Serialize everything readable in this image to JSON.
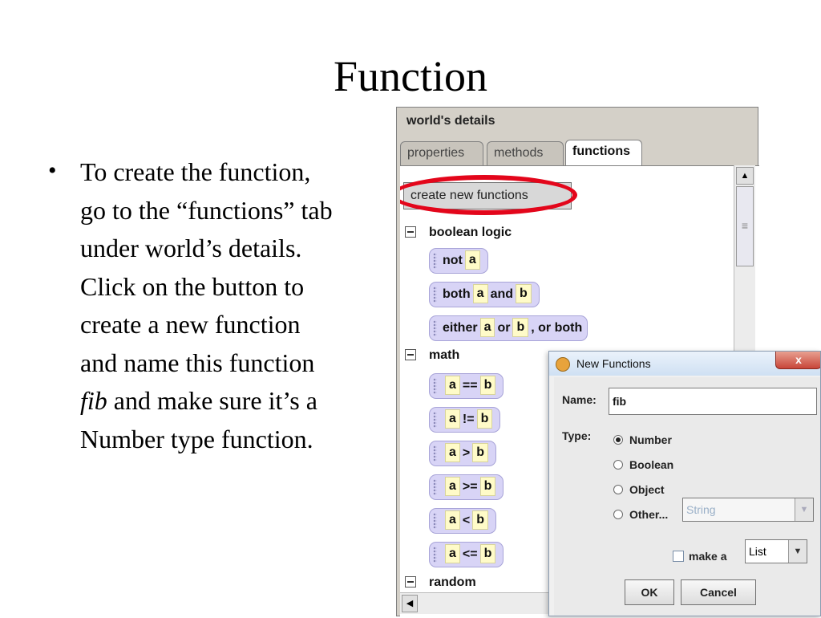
{
  "slide": {
    "title": "Function",
    "bullet": "•",
    "lines": [
      "To create the function,",
      "go to the “functions” tab",
      "under world’s details.",
      "Click on the button to",
      "create a new function",
      "and name this function",
      " and make sure it’s a",
      "Number type function."
    ],
    "emphasis": "fib"
  },
  "panel": {
    "header": "world's details",
    "tabs": [
      "properties",
      "methods",
      "functions"
    ],
    "active_tab": "functions",
    "create_button": "create new functions",
    "categories": {
      "boolean": "boolean logic",
      "math": "math",
      "random": "random"
    },
    "boolean_tiles": {
      "not": {
        "op": "not",
        "a": "a"
      },
      "both": {
        "op": "both",
        "a": "a",
        "mid": "and",
        "b": "b"
      },
      "either": {
        "op": "either",
        "a": "a",
        "mid": "or",
        "b": "b",
        "tail": ", or both"
      }
    },
    "math_tiles": [
      {
        "a": "a",
        "op": "==",
        "b": "b"
      },
      {
        "a": "a",
        "op": "!=",
        "b": "b"
      },
      {
        "a": "a",
        "op": ">",
        "b": "b"
      },
      {
        "a": "a",
        "op": ">=",
        "b": "b"
      },
      {
        "a": "a",
        "op": "<",
        "b": "b"
      },
      {
        "a": "a",
        "op": "<=",
        "b": "b"
      }
    ]
  },
  "dialog": {
    "title": "New Functions",
    "close": "x",
    "name_label": "Name:",
    "name_value": "fib",
    "type_label": "Type:",
    "types": [
      "Number",
      "Boolean",
      "Object",
      "Other..."
    ],
    "selected_type": "Number",
    "other_select": "String",
    "make_a_label": "make a",
    "list_select": "List",
    "ok": "OK",
    "cancel": "Cancel"
  },
  "colors": {
    "highlight_oval": "#e3061b",
    "tile_background": "#d8d4f6",
    "slot_background": "#fffbc8"
  },
  "icons": [
    "collapse-icon",
    "scroll-up-icon",
    "scroll-left-icon",
    "dialog-app-icon",
    "close-icon",
    "dropdown-arrow-icon"
  ]
}
